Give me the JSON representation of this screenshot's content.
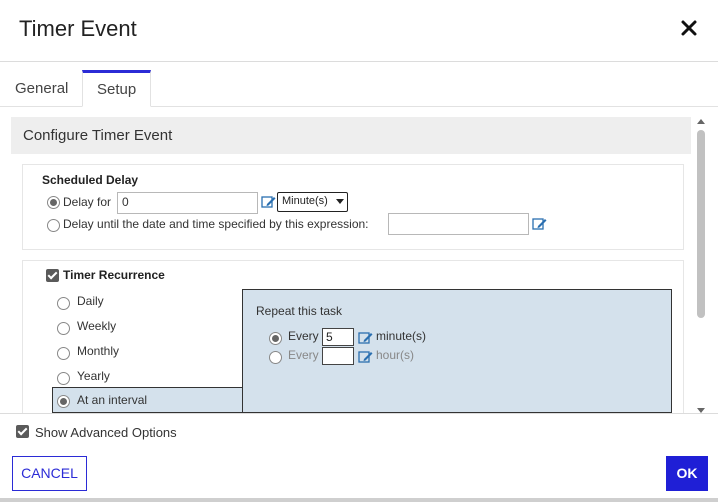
{
  "dialog": {
    "title": "Timer Event"
  },
  "tabs": [
    {
      "label": "General",
      "active": false
    },
    {
      "label": "Setup",
      "active": true
    }
  ],
  "section": {
    "title": "Configure Timer Event"
  },
  "scheduled_delay": {
    "heading": "Scheduled Delay",
    "option_delay_for": {
      "label": "Delay for",
      "selected": true,
      "value": "0",
      "unit": "Minute(s)"
    },
    "option_delay_until": {
      "label": "Delay until the date and time specified by this expression:",
      "selected": false,
      "value": ""
    }
  },
  "recurrence": {
    "checkbox_label": "Timer Recurrence",
    "checked": true,
    "options": [
      "Daily",
      "Weekly",
      "Monthly",
      "Yearly",
      "At an interval"
    ],
    "selected": "At an interval",
    "panel": {
      "heading": "Repeat this task",
      "rows": [
        {
          "prefix": "Every",
          "value": "5",
          "unit": "minute(s)",
          "selected": true
        },
        {
          "prefix": "Every",
          "value": "",
          "unit": "hour(s)",
          "selected": false
        }
      ]
    }
  },
  "footer": {
    "show_advanced_label": "Show Advanced Options",
    "show_advanced_checked": true,
    "cancel_label": "CANCEL",
    "ok_label": "OK"
  },
  "colors": {
    "accent": "#2b2bd6",
    "panel": "#d4e1ec",
    "edit_icon": "#2a6fb0"
  }
}
